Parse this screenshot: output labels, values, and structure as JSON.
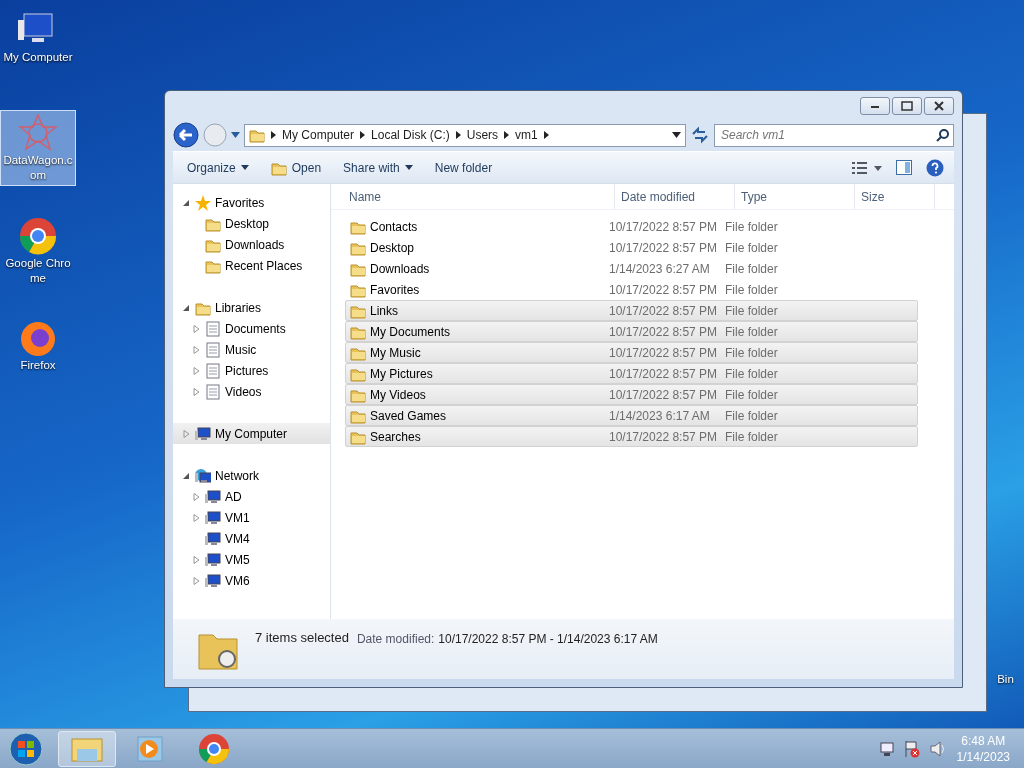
{
  "desktop_icons": [
    {
      "label": "My Computer",
      "selected": false
    },
    {
      "label": "DataWagon.com",
      "selected": true
    },
    {
      "label": "Google Chrome",
      "selected": false
    },
    {
      "label": "Firefox",
      "selected": false
    },
    {
      "label": "Bin",
      "selected": false
    }
  ],
  "explorer": {
    "breadcrumb": [
      "My Computer",
      "Local Disk (C:)",
      "Users",
      "vm1"
    ],
    "search": {
      "placeholder": "Search vm1"
    },
    "toolbar": [
      {
        "label": "Organize",
        "dropdown": true
      },
      {
        "label": "Open",
        "dropdown": false
      },
      {
        "label": "Share with",
        "dropdown": true
      },
      {
        "label": "New folder",
        "dropdown": false
      }
    ],
    "nav": [
      {
        "label": "Favorites",
        "expandable": true,
        "expanded": true,
        "selected": false,
        "children": [
          {
            "label": "Desktop",
            "expandable": false
          },
          {
            "label": "Downloads",
            "expandable": false
          },
          {
            "label": "Recent Places",
            "expandable": false
          }
        ]
      },
      {
        "label": "Libraries",
        "expandable": true,
        "expanded": true,
        "selected": false,
        "children": [
          {
            "label": "Documents",
            "expandable": true
          },
          {
            "label": "Music",
            "expandable": true
          },
          {
            "label": "Pictures",
            "expandable": true
          },
          {
            "label": "Videos",
            "expandable": true
          }
        ]
      },
      {
        "label": "My Computer",
        "expandable": true,
        "expanded": false,
        "selected": true
      },
      {
        "label": "Network",
        "expandable": true,
        "expanded": true,
        "selected": false,
        "children": [
          {
            "label": "AD",
            "expandable": true
          },
          {
            "label": "VM1",
            "expandable": true
          },
          {
            "label": "VM4",
            "expandable": false
          },
          {
            "label": "VM5",
            "expandable": true
          },
          {
            "label": "VM6",
            "expandable": true
          }
        ]
      }
    ],
    "columns": [
      "Name",
      "Date modified",
      "Type",
      "Size"
    ],
    "rows": [
      {
        "name": "Contacts",
        "date": "10/17/2022 8:57 PM",
        "type": "File folder",
        "selected": false
      },
      {
        "name": "Desktop",
        "date": "10/17/2022 8:57 PM",
        "type": "File folder",
        "selected": false
      },
      {
        "name": "Downloads",
        "date": "1/14/2023 6:27 AM",
        "type": "File folder",
        "selected": false
      },
      {
        "name": "Favorites",
        "date": "10/17/2022 8:57 PM",
        "type": "File folder",
        "selected": false
      },
      {
        "name": "Links",
        "date": "10/17/2022 8:57 PM",
        "type": "File folder",
        "selected": true
      },
      {
        "name": "My Documents",
        "date": "10/17/2022 8:57 PM",
        "type": "File folder",
        "selected": true
      },
      {
        "name": "My Music",
        "date": "10/17/2022 8:57 PM",
        "type": "File folder",
        "selected": true
      },
      {
        "name": "My Pictures",
        "date": "10/17/2022 8:57 PM",
        "type": "File folder",
        "selected": true
      },
      {
        "name": "My Videos",
        "date": "10/17/2022 8:57 PM",
        "type": "File folder",
        "selected": true
      },
      {
        "name": "Saved Games",
        "date": "1/14/2023 6:17 AM",
        "type": "File folder",
        "selected": true
      },
      {
        "name": "Searches",
        "date": "10/17/2022 8:57 PM",
        "type": "File folder",
        "selected": true
      }
    ],
    "status": {
      "count": "7 items selected",
      "label": "Date modified:",
      "value": "10/17/2022 8:57 PM - 1/14/2023 6:17 AM"
    }
  },
  "taskbar": {
    "time": "6:48 AM",
    "date": "1/14/2023"
  }
}
